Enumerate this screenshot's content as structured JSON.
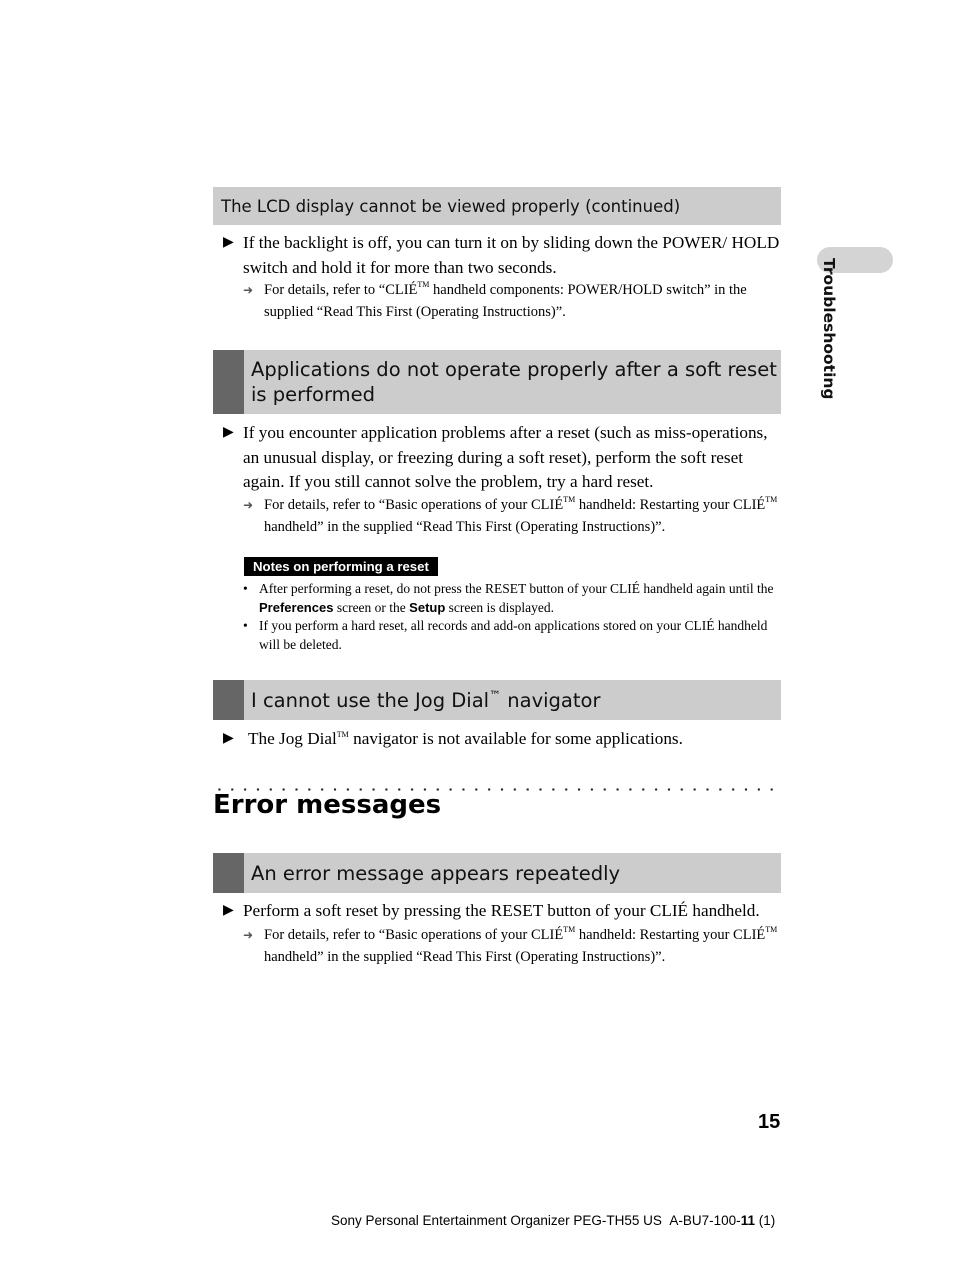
{
  "side_tab": {
    "label": "Troubleshooting"
  },
  "sections": [
    {
      "heading": "The LCD display cannot be viewed properly (continued)",
      "bullet": "If the backlight is off, you can turn it on by sliding down the POWER/ HOLD switch and hold it for more than two seconds.",
      "ref": {
        "pre": "For details, refer to “CLIÉ",
        "tm": "TM",
        "post": " handheld components: POWER/HOLD switch” in the supplied “Read This First (Operating Instructions)”."
      }
    },
    {
      "heading": "Applications do not operate properly after a soft reset is performed",
      "bullet": "If you encounter application problems after a reset (such as miss-operations, an unusual display, or freezing during a soft reset), perform the soft reset again. If you still cannot solve the problem, try a hard reset.",
      "ref": {
        "pre": "For details, refer to “Basic operations of your CLIÉ",
        "tm": "TM",
        "mid": " handheld: Restarting your CLIÉ",
        "post": " handheld” in the supplied “Read This First (Operating Instructions)”."
      },
      "notes": {
        "label": "Notes on performing a reset",
        "items": [
          {
            "pre": "After performing a reset, do not press the RESET button of your CLIÉ handheld again until the ",
            "b1": "Preferences",
            "mid": " screen or the ",
            "b2": "Setup",
            "post": " screen is displayed."
          },
          {
            "text": "If you perform a hard reset, all records and add-on applications stored on your CLIÉ handheld will be deleted."
          }
        ]
      }
    },
    {
      "heading_pre": "I cannot use the Jog Dial",
      "heading_tm": "™",
      "heading_post": " navigator",
      "bullet_pre": "The Jog Dial",
      "bullet_tm": "TM",
      "bullet_post": " navigator is not available for some applications."
    }
  ],
  "error_section": {
    "title": "Error messages",
    "heading": "An error message appears repeatedly",
    "bullet": "Perform a soft reset by pressing the RESET button of your CLIÉ handheld.",
    "ref": {
      "pre": "For details, refer to “Basic operations of your CLIÉ",
      "tm": "TM",
      "mid": " handheld: Restarting your CLIÉ",
      "post": " handheld” in the supplied “Read This First (Operating Instructions)”."
    }
  },
  "glyphs": {
    "bullet": "▶",
    "ref_arrow": "➜",
    "dot": "•"
  },
  "page_number": "15",
  "footer": {
    "pre": "Sony Personal Entertainment Organizer PEG-TH55 US  A-BU7-100-",
    "bold": "11",
    "post": " (1)"
  },
  "colors": {
    "heading_bar": "#cccccc",
    "heading_accent": "#666666",
    "side_tab": "#d4d4d4"
  }
}
